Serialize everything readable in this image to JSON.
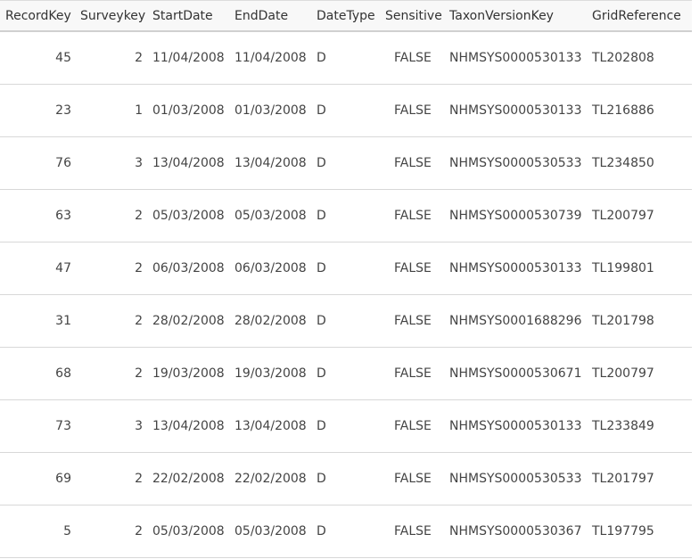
{
  "columns": [
    {
      "key": "recordkey",
      "label": "RecordKey"
    },
    {
      "key": "surveykey",
      "label": "Surveykey"
    },
    {
      "key": "startdate",
      "label": "StartDate"
    },
    {
      "key": "enddate",
      "label": "EndDate"
    },
    {
      "key": "datetype",
      "label": "DateType"
    },
    {
      "key": "sensitive",
      "label": "Sensitive"
    },
    {
      "key": "taxon",
      "label": "TaxonVersionKey"
    },
    {
      "key": "grid",
      "label": "GridReference"
    }
  ],
  "rows": [
    {
      "recordkey": "45",
      "surveykey": "2",
      "startdate": "11/04/2008",
      "enddate": "11/04/2008",
      "datetype": "D",
      "sensitive": "FALSE",
      "taxon": "NHMSYS0000530133",
      "grid": "TL202808"
    },
    {
      "recordkey": "23",
      "surveykey": "1",
      "startdate": "01/03/2008",
      "enddate": "01/03/2008",
      "datetype": "D",
      "sensitive": "FALSE",
      "taxon": "NHMSYS0000530133",
      "grid": "TL216886"
    },
    {
      "recordkey": "76",
      "surveykey": "3",
      "startdate": "13/04/2008",
      "enddate": "13/04/2008",
      "datetype": "D",
      "sensitive": "FALSE",
      "taxon": "NHMSYS0000530533",
      "grid": "TL234850"
    },
    {
      "recordkey": "63",
      "surveykey": "2",
      "startdate": "05/03/2008",
      "enddate": "05/03/2008",
      "datetype": "D",
      "sensitive": "FALSE",
      "taxon": "NHMSYS0000530739",
      "grid": "TL200797"
    },
    {
      "recordkey": "47",
      "surveykey": "2",
      "startdate": "06/03/2008",
      "enddate": "06/03/2008",
      "datetype": "D",
      "sensitive": "FALSE",
      "taxon": "NHMSYS0000530133",
      "grid": "TL199801"
    },
    {
      "recordkey": "31",
      "surveykey": "2",
      "startdate": "28/02/2008",
      "enddate": "28/02/2008",
      "datetype": "D",
      "sensitive": "FALSE",
      "taxon": "NHMSYS0001688296",
      "grid": "TL201798"
    },
    {
      "recordkey": "68",
      "surveykey": "2",
      "startdate": "19/03/2008",
      "enddate": "19/03/2008",
      "datetype": "D",
      "sensitive": "FALSE",
      "taxon": "NHMSYS0000530671",
      "grid": "TL200797"
    },
    {
      "recordkey": "73",
      "surveykey": "3",
      "startdate": "13/04/2008",
      "enddate": "13/04/2008",
      "datetype": "D",
      "sensitive": "FALSE",
      "taxon": "NHMSYS0000530133",
      "grid": "TL233849"
    },
    {
      "recordkey": "69",
      "surveykey": "2",
      "startdate": "22/02/2008",
      "enddate": "22/02/2008",
      "datetype": "D",
      "sensitive": "FALSE",
      "taxon": "NHMSYS0000530533",
      "grid": "TL201797"
    },
    {
      "recordkey": "5",
      "surveykey": "2",
      "startdate": "05/03/2008",
      "enddate": "05/03/2008",
      "datetype": "D",
      "sensitive": "FALSE",
      "taxon": "NHMSYS0000530367",
      "grid": "TL197795"
    }
  ]
}
